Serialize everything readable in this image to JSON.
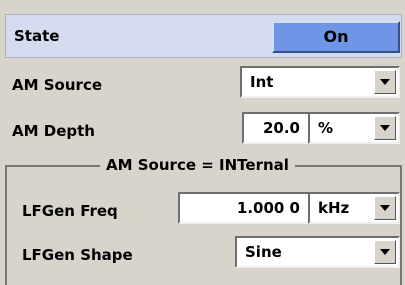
{
  "state": {
    "label": "State",
    "value": "On"
  },
  "am_source": {
    "label": "AM Source",
    "value": "Int"
  },
  "am_depth": {
    "label": "AM Depth",
    "value": "20.0",
    "unit": "%"
  },
  "group": {
    "title": "AM Source = INTernal"
  },
  "lfgen_freq": {
    "label": "LFGen Freq",
    "value": "1.000 0",
    "unit": "kHz"
  },
  "lfgen_shape": {
    "label": "LFGen Shape",
    "value": "Sine"
  }
}
